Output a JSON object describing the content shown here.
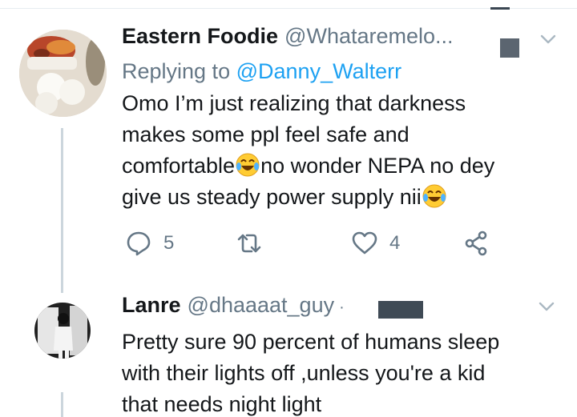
{
  "tweets": [
    {
      "display_name": "Eastern Foodie",
      "handle": "@Whataremelo...",
      "replying_prefix": "Replying to",
      "replying_to": "@Danny_Walterr",
      "text_line1": "Omo I’m just realizing that darkness",
      "text_line2": "makes some ppl feel safe and",
      "text_line3a": "comfortable",
      "text_line3b": "no wonder NEPA no dey",
      "text_line4": "give us steady power supply nii",
      "reply_count": "5",
      "like_count": "4",
      "avatar_icon": "food-avatar-icon"
    },
    {
      "display_name": "Lanre",
      "handle": "@dhaaaat_guy",
      "dot": "·",
      "text_line1": "Pretty sure 90 percent of humans sleep",
      "text_line2": "with their lights off ,unless you're a kid",
      "text_line3": "that needs night light",
      "avatar_icon": "person-photo-avatar-icon"
    }
  ],
  "icons": {
    "reply": "reply-icon",
    "retweet": "retweet-icon",
    "like": "heart-icon",
    "share": "share-icon",
    "more": "chevron-down-icon",
    "emoji": "face-with-tears-of-joy-icon"
  },
  "colors": {
    "text": "#14171a",
    "secondary": "#657786",
    "link": "#1da1f2",
    "thread_line": "#ccd6dd"
  }
}
